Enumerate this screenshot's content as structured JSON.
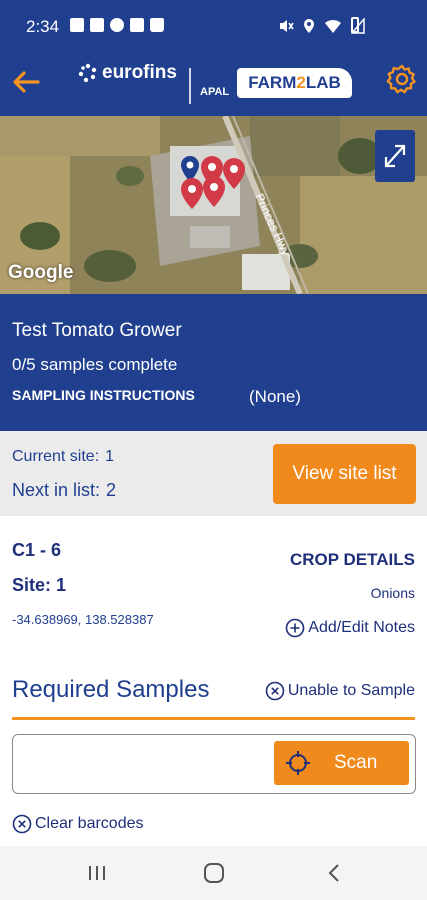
{
  "status_bar": {
    "time": "2:34",
    "left_icons": [
      "app-grid-icon",
      "mail-icon",
      "timer-icon",
      "image-icon",
      "shopping-bag-icon"
    ],
    "right_icons": [
      "mute-icon",
      "location-icon",
      "wifi-icon",
      "signal-icon",
      "battery-icon"
    ]
  },
  "header": {
    "brand": "eurofins",
    "apal": "APAL",
    "farm_part1": "FARM",
    "farm_two": "2",
    "farm_part2": "LAB",
    "accent_color": "#f39322",
    "header_color": "#203f8f"
  },
  "map": {
    "attribution": "Google",
    "road_label": "Princes Hwy"
  },
  "grower": {
    "name": "Test Tomato Grower",
    "samples_status": "0/5 samples complete",
    "instructions_label": "SAMPLING INSTRUCTIONS",
    "instructions_value": "(None)"
  },
  "site_bar": {
    "current_label": "Current site:",
    "current_value": "1",
    "next_label": "Next in list:",
    "next_value": "2",
    "view_button": "View site list"
  },
  "details": {
    "crop_code": "C1 - 6",
    "site": "Site: 1",
    "coordinates": "-34.638969, 138.528387",
    "crop_details_label": "CROP DETAILS",
    "crop_value": "Onions",
    "add_notes": "Add/Edit Notes",
    "required_title": "Required Samples",
    "unable": "Unable to Sample",
    "barcode_value": "",
    "scan_label": "Scan",
    "clear_barcodes": "Clear barcodes"
  }
}
